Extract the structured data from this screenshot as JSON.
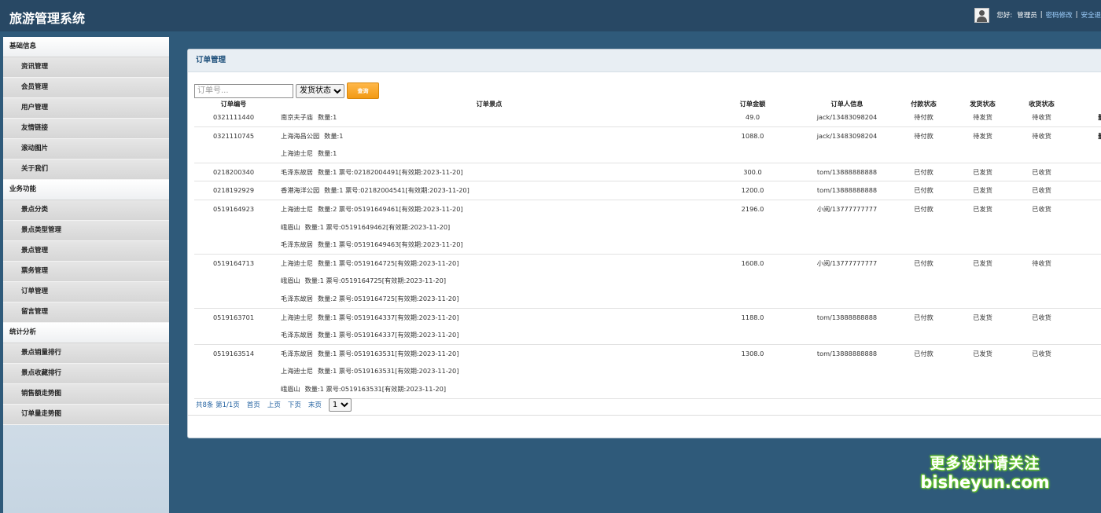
{
  "app": {
    "title": "旅游管理系统"
  },
  "header": {
    "greeting": "您好:",
    "username": "管理员",
    "separator": "|",
    "change_password": "密码修改",
    "security_exit": "安全退"
  },
  "sidebar": {
    "groups": [
      {
        "title": "基础信息",
        "items": [
          "资讯管理",
          "会员管理",
          "用户管理",
          "友情链接",
          "滚动图片",
          "关于我们"
        ]
      },
      {
        "title": "业务功能",
        "items": [
          "景点分类",
          "景点类型管理",
          "景点管理",
          "票务管理",
          "订单管理",
          "留言管理"
        ]
      },
      {
        "title": "统计分析",
        "items": [
          "景点销量排行",
          "景点收藏排行",
          "销售额走势图",
          "订单量走势图"
        ]
      }
    ]
  },
  "panel": {
    "title": "订单管理"
  },
  "search": {
    "order_placeholder": "订单号...",
    "status_select": "发货状态",
    "button_label": "查询"
  },
  "table": {
    "columns": [
      "订单编号",
      "订单景点",
      "订单金额",
      "订单人信息",
      "付款状态",
      "发货状态",
      "收货状态",
      ""
    ],
    "rows": [
      {
        "order_no": "0321111440",
        "spots": [
          {
            "name": "南京夫子庙",
            "detail": "数量:1"
          }
        ],
        "amount": "49.0",
        "customer": "jack/13483098204",
        "pay": "待付款",
        "ship": "待发货",
        "receive": "待收货",
        "op": "删除"
      },
      {
        "order_no": "0321110745",
        "spots": [
          {
            "name": "上海海昌公园",
            "detail": "数量:1"
          },
          {
            "name": "上海迪士尼",
            "detail": "数量:1"
          }
        ],
        "amount": "1088.0",
        "customer": "jack/13483098204",
        "pay": "待付款",
        "ship": "待发货",
        "receive": "待收货",
        "op": "删除"
      },
      {
        "order_no": "0218200340",
        "spots": [
          {
            "name": "毛泽东故居",
            "detail": "数量:1 票号:02182004491[有效期:2023-11-20]"
          }
        ],
        "amount": "300.0",
        "customer": "tom/13888888888",
        "pay": "已付款",
        "ship": "已发货",
        "receive": "已收货",
        "op": ""
      },
      {
        "order_no": "0218192929",
        "spots": [
          {
            "name": "香港海洋公园",
            "detail": "数量:1 票号:02182004541[有效期:2023-11-20]"
          }
        ],
        "amount": "1200.0",
        "customer": "tom/13888888888",
        "pay": "已付款",
        "ship": "已发货",
        "receive": "已收货",
        "op": ""
      },
      {
        "order_no": "0519164923",
        "spots": [
          {
            "name": "上海迪士尼",
            "detail": "数量:2 票号:05191649461[有效期:2023-11-20]"
          },
          {
            "name": "峨眉山",
            "detail": "数量:1 票号:05191649462[有效期:2023-11-20]"
          },
          {
            "name": "毛泽东故居",
            "detail": "数量:1 票号:05191649463[有效期:2023-11-20]"
          }
        ],
        "amount": "2196.0",
        "customer": "小阅/13777777777",
        "pay": "已付款",
        "ship": "已发货",
        "receive": "已收货",
        "op": ""
      },
      {
        "order_no": "0519164713",
        "spots": [
          {
            "name": "上海迪士尼",
            "detail": "数量:1 票号:0519164725[有效期:2023-11-20]"
          },
          {
            "name": "峨眉山",
            "detail": "数量:1 票号:0519164725[有效期:2023-11-20]"
          },
          {
            "name": "毛泽东故居",
            "detail": "数量:2 票号:0519164725[有效期:2023-11-20]"
          }
        ],
        "amount": "1608.0",
        "customer": "小阅/13777777777",
        "pay": "已付款",
        "ship": "已发货",
        "receive": "待收货",
        "op": ""
      },
      {
        "order_no": "0519163701",
        "spots": [
          {
            "name": "上海迪士尼",
            "detail": "数量:1 票号:0519164337[有效期:2023-11-20]"
          },
          {
            "name": "毛泽东故居",
            "detail": "数量:1 票号:0519164337[有效期:2023-11-20]"
          }
        ],
        "amount": "1188.0",
        "customer": "tom/13888888888",
        "pay": "已付款",
        "ship": "已发货",
        "receive": "已收货",
        "op": ""
      },
      {
        "order_no": "0519163514",
        "spots": [
          {
            "name": "毛泽东故居",
            "detail": "数量:1 票号:0519163531[有效期:2023-11-20]"
          },
          {
            "name": "上海迪士尼",
            "detail": "数量:1 票号:0519163531[有效期:2023-11-20]"
          },
          {
            "name": "峨眉山",
            "detail": "数量:1 票号:0519163531[有效期:2023-11-20]"
          }
        ],
        "amount": "1308.0",
        "customer": "tom/13888888888",
        "pay": "已付款",
        "ship": "已发货",
        "receive": "已收货",
        "op": ""
      }
    ]
  },
  "pager": {
    "summary": "共8条 第1/1页",
    "first": "首页",
    "prev": "上页",
    "next": "下页",
    "last": "末页",
    "page_value": "1"
  },
  "watermark": {
    "line1": "更多设计请关注",
    "line2": "bisheyun.com"
  }
}
